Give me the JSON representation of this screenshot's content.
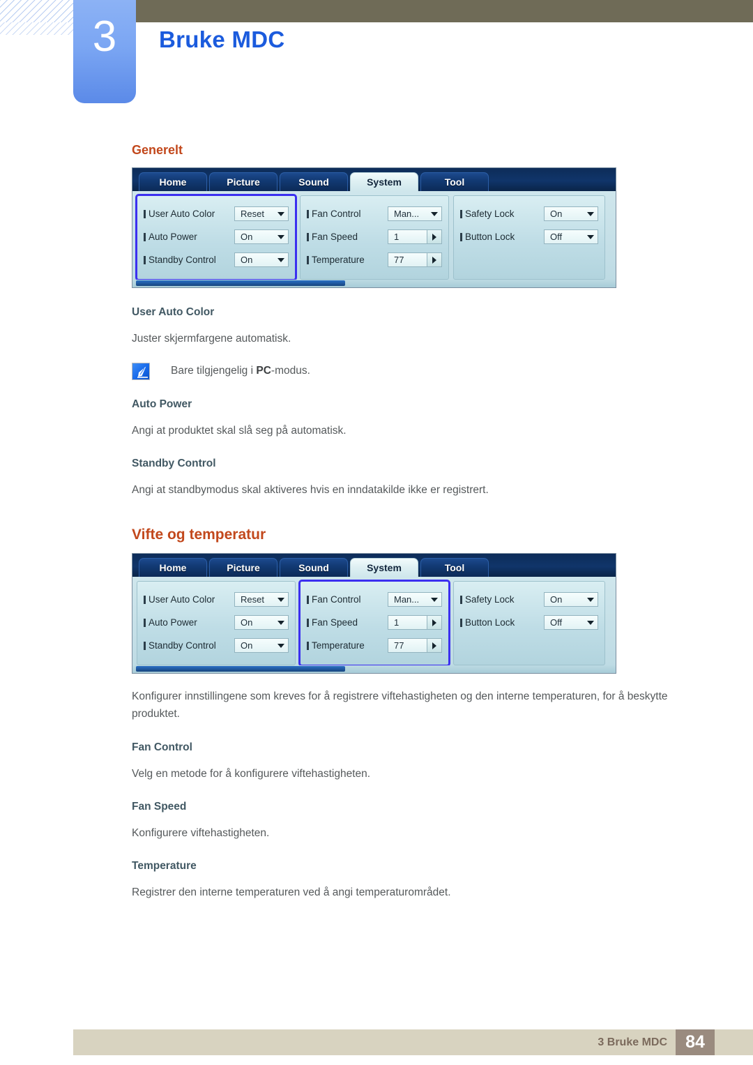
{
  "header": {
    "chapter_number": "3",
    "chapter_title": "Bruke MDC",
    "title_color": "#1b5bdd",
    "badge_color": "#7ba6f3",
    "topbar_color": "#6f6b57"
  },
  "sections": {
    "general_heading": "Generelt",
    "fan_heading": "Vifte og temperatur",
    "heading_color": "#c2481c",
    "terms": {
      "user_auto_color": "User Auto Color",
      "auto_power": "Auto Power",
      "standby_control": "Standby Control",
      "fan_control": "Fan Control",
      "fan_speed": "Fan Speed",
      "temperature": "Temperature"
    },
    "body": {
      "user_auto_color_desc": "Juster skjermfargene automatisk.",
      "note_prefix": "Bare tilgjengelig i ",
      "note_bold": "PC",
      "note_suffix": "-modus.",
      "auto_power_desc": "Angi at produktet skal slå seg på automatisk.",
      "standby_control_desc": "Angi at standbymodus skal aktiveres hvis en inndatakilde ikke er registrert.",
      "fan_intro": "Konfigurer innstillingene som kreves for å registrere viftehastigheten og den interne temperaturen, for å beskytte produktet.",
      "fan_control_desc": "Velg en metode for å konfigurere viftehastigheten.",
      "fan_speed_desc": "Konfigurere viftehastigheten.",
      "temperature_desc": "Registrer den interne temperaturen ved å angi temperaturområdet."
    }
  },
  "mdc": {
    "tabs": [
      {
        "label": "Home",
        "active": false
      },
      {
        "label": "Picture",
        "active": false
      },
      {
        "label": "Sound",
        "active": false
      },
      {
        "label": "System",
        "active": true
      },
      {
        "label": "Tool",
        "active": false
      }
    ],
    "group1": {
      "rows": [
        {
          "label": "User Auto Color",
          "value": "Reset",
          "control": "dropdown"
        },
        {
          "label": "Auto Power",
          "value": "On",
          "control": "dropdown"
        },
        {
          "label": "Standby Control",
          "value": "On",
          "control": "dropdown"
        }
      ]
    },
    "group2": {
      "rows": [
        {
          "label": "Fan Control",
          "value": "Man...",
          "control": "dropdown"
        },
        {
          "label": "Fan Speed",
          "value": "1",
          "control": "spinner"
        },
        {
          "label": "Temperature",
          "value": "77",
          "control": "spinner"
        }
      ]
    },
    "group3": {
      "rows": [
        {
          "label": "Safety Lock",
          "value": "On",
          "control": "dropdown"
        },
        {
          "label": "Button Lock",
          "value": "Off",
          "control": "dropdown"
        }
      ]
    },
    "highlight_color": "#3b2ff0",
    "highlight_first": "group1",
    "highlight_second": "group2"
  },
  "footer": {
    "text": "3 Bruke MDC",
    "page_number": "84",
    "bar_color": "#d8d3c0",
    "page_box_color": "#9a8b7f"
  }
}
